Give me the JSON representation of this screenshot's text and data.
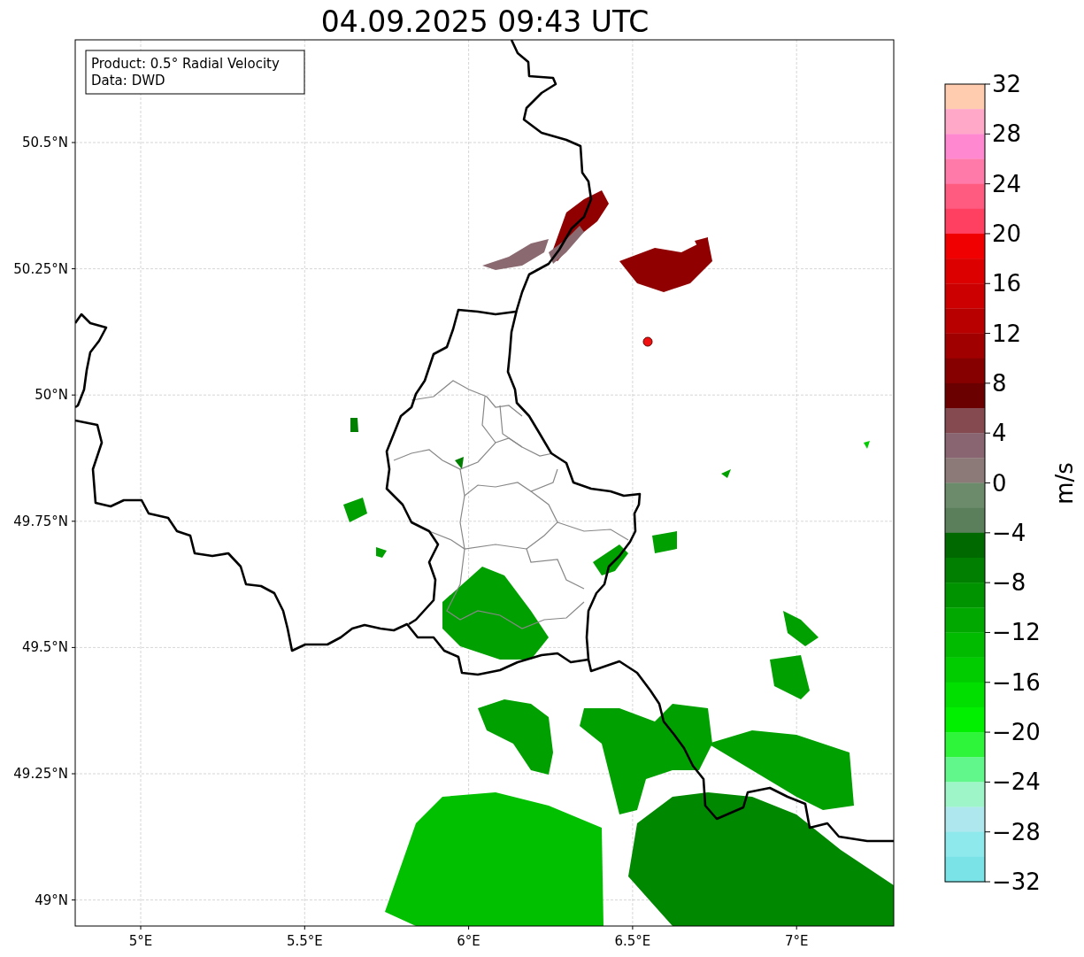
{
  "title": "04.09.2025 09:43 UTC",
  "info_box": [
    "Product: 0.5° Radial Velocity",
    "Data: DWD"
  ],
  "map": {
    "x_ticks": [
      "5°E",
      "5.5°E",
      "6°E",
      "6.5°E",
      "7°E"
    ],
    "y_ticks": [
      "50.5°N",
      "50.25°N",
      "50°N",
      "49.75°N",
      "49.5°N",
      "49.25°N",
      "49°N"
    ]
  },
  "colorbar": {
    "label": "m/s",
    "ticks": [
      "32",
      "28",
      "24",
      "20",
      "16",
      "12",
      "8",
      "4",
      "0",
      "−4",
      "−8",
      "−12",
      "−16",
      "−20",
      "−24",
      "−28",
      "−32"
    ],
    "segments": [
      {
        "color": "#ffccb0"
      },
      {
        "color": "#ffa8c8"
      },
      {
        "color": "#ff88d0"
      },
      {
        "color": "#ff7aa8"
      },
      {
        "color": "#ff5a80"
      },
      {
        "color": "#ff4060"
      },
      {
        "color": "#f00000"
      },
      {
        "color": "#dd0000"
      },
      {
        "color": "#cc0000"
      },
      {
        "color": "#b90000"
      },
      {
        "color": "#a00000"
      },
      {
        "color": "#860000"
      },
      {
        "color": "#6a0000"
      },
      {
        "color": "#854a50"
      },
      {
        "color": "#886570"
      },
      {
        "color": "#8c7a78"
      },
      {
        "color": "#6b8b6b"
      },
      {
        "color": "#5a7f5a"
      },
      {
        "color": "#006a00"
      },
      {
        "color": "#007f00"
      },
      {
        "color": "#009300"
      },
      {
        "color": "#00a800"
      },
      {
        "color": "#00bb00"
      },
      {
        "color": "#00cc00"
      },
      {
        "color": "#00df00"
      },
      {
        "color": "#00f000"
      },
      {
        "color": "#2ef53a"
      },
      {
        "color": "#62f78a"
      },
      {
        "color": "#9ef5c8"
      },
      {
        "color": "#aee8ee"
      },
      {
        "color": "#8ee9ec"
      },
      {
        "color": "#7ae3e8"
      }
    ]
  }
}
